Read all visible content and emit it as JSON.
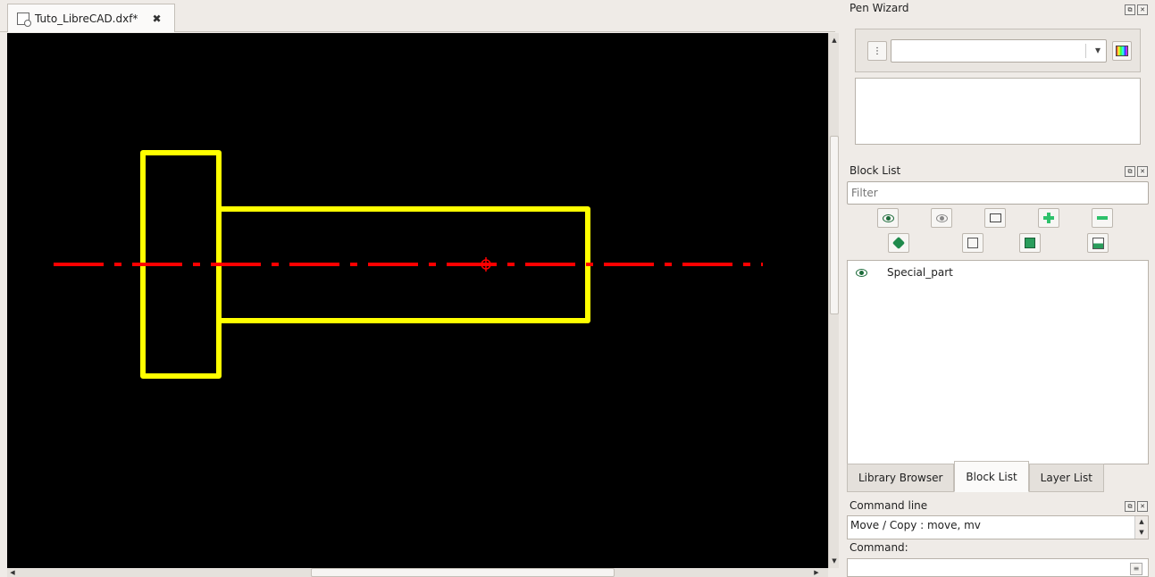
{
  "document": {
    "tab_title": "Tuto_LibreCAD.dxf*",
    "tab_close": "✖"
  },
  "drawing": {
    "background_color": "#000000",
    "shape_color": "#ffff00",
    "centerline_color": "#ff0000"
  },
  "pen_wizard": {
    "title": "Pen Wizard",
    "dock_float": "⧉",
    "dock_close": "✕",
    "small_button": "⋮",
    "combo_value": "",
    "combo_arrow": "▾"
  },
  "block_list": {
    "title": "Block List",
    "dock_float": "⧉",
    "dock_close": "✕",
    "filter_placeholder": "Filter",
    "toolbar_row1": [
      "eye-show-all-icon",
      "eye-hide-all-icon",
      "create-block-icon",
      "add-block-icon",
      "remove-block-icon"
    ],
    "toolbar_row2": [
      "edit-block-icon",
      "insert-block-icon",
      "save-block-icon",
      "save-as-block-icon"
    ],
    "items": [
      {
        "name": "Special_part",
        "visible": true
      }
    ]
  },
  "dock_tabs": {
    "tabs": [
      "Library Browser",
      "Block List",
      "Layer List"
    ],
    "active": "Block List"
  },
  "command_line": {
    "title": "Command line",
    "dock_float": "⧉",
    "dock_close": "✕",
    "history_line": "Move / Copy : move, mv",
    "command_label": "Command:",
    "command_value": ""
  }
}
